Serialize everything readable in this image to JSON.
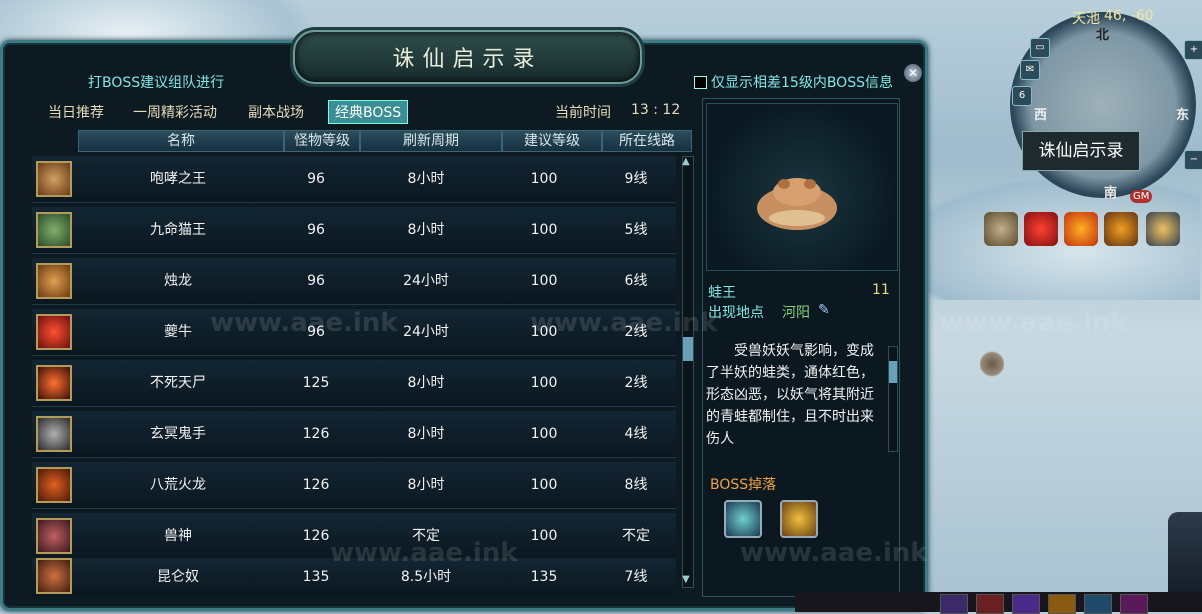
{
  "window": {
    "title": "诛仙启示录",
    "hint": "打BOSS建议组队进行",
    "filter_label": "仅显示相差15级内BOSS信息",
    "close_glyph": "✕"
  },
  "tabs": [
    {
      "label": "当日推荐"
    },
    {
      "label": "一周精彩活动"
    },
    {
      "label": "副本战场"
    },
    {
      "label": "经典BOSS",
      "active": true
    }
  ],
  "time": {
    "label": "当前时间",
    "value": "13 : 12"
  },
  "table": {
    "headers": [
      "名称",
      "怪物等级",
      "刷新周期",
      "建议等级",
      "所在线路"
    ],
    "rows": [
      {
        "name": "咆哮之王",
        "level": "96",
        "refresh": "8小时",
        "suggest": "100",
        "line": "9线"
      },
      {
        "name": "九命猫王",
        "level": "96",
        "refresh": "8小时",
        "suggest": "100",
        "line": "5线"
      },
      {
        "name": "烛龙",
        "level": "96",
        "refresh": "24小时",
        "suggest": "100",
        "line": "6线"
      },
      {
        "name": "夔牛",
        "level": "96",
        "refresh": "24小时",
        "suggest": "100",
        "line": "2线"
      },
      {
        "name": "不死天尸",
        "level": "125",
        "refresh": "8小时",
        "suggest": "100",
        "line": "2线"
      },
      {
        "name": "玄冥鬼手",
        "level": "126",
        "refresh": "8小时",
        "suggest": "100",
        "line": "4线"
      },
      {
        "name": "八荒火龙",
        "level": "126",
        "refresh": "8小时",
        "suggest": "100",
        "line": "8线"
      },
      {
        "name": "兽神",
        "level": "126",
        "refresh": "不定",
        "suggest": "100",
        "line": "不定"
      },
      {
        "name": "昆仑奴",
        "level": "135",
        "refresh": "8.5小时",
        "suggest": "135",
        "line": "7线"
      }
    ]
  },
  "detail": {
    "boss_name": "蛙王",
    "boss_level": "11",
    "location_label": "出现地点",
    "location_value": "河阳",
    "description": "受兽妖妖气影响，变成了半妖的蛙类，通体红色，形态凶恶，以妖气将其附近的青蛙都制住，且不时出来伤人",
    "drops_label": "BOSS掉落"
  },
  "minimap": {
    "area": "天池",
    "coords": "46, -60",
    "tooltip": "诛仙启示录",
    "north": "北",
    "south": "南",
    "east": "东",
    "west": "西",
    "gm_badge": "GM"
  },
  "colors": {
    "accent_cyan": "#7fe7e3",
    "drop_orange": "#f0a040",
    "location_green": "#7fd97f"
  },
  "watermark": "www.aae.ink"
}
